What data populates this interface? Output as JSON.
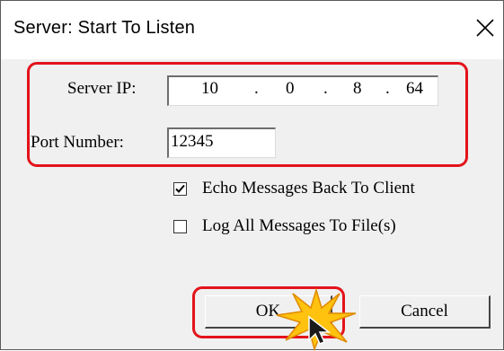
{
  "window": {
    "title": "Server: Start To Listen"
  },
  "server_ip": {
    "label": "Server IP:",
    "octets": [
      "10",
      "0",
      "8",
      "64"
    ],
    "separator": "."
  },
  "port": {
    "label": "Port Number:",
    "value": "12345"
  },
  "options": {
    "echo": {
      "label": "Echo Messages Back To Client",
      "checked": true
    },
    "log": {
      "label": "Log All Messages To File(s)",
      "checked": false
    }
  },
  "buttons": {
    "ok": "OK",
    "cancel": "Cancel"
  },
  "colors": {
    "highlight": "#e3131b",
    "dialog_bg": "#f0f0f0",
    "cursor_burst": "#ffc20e"
  }
}
